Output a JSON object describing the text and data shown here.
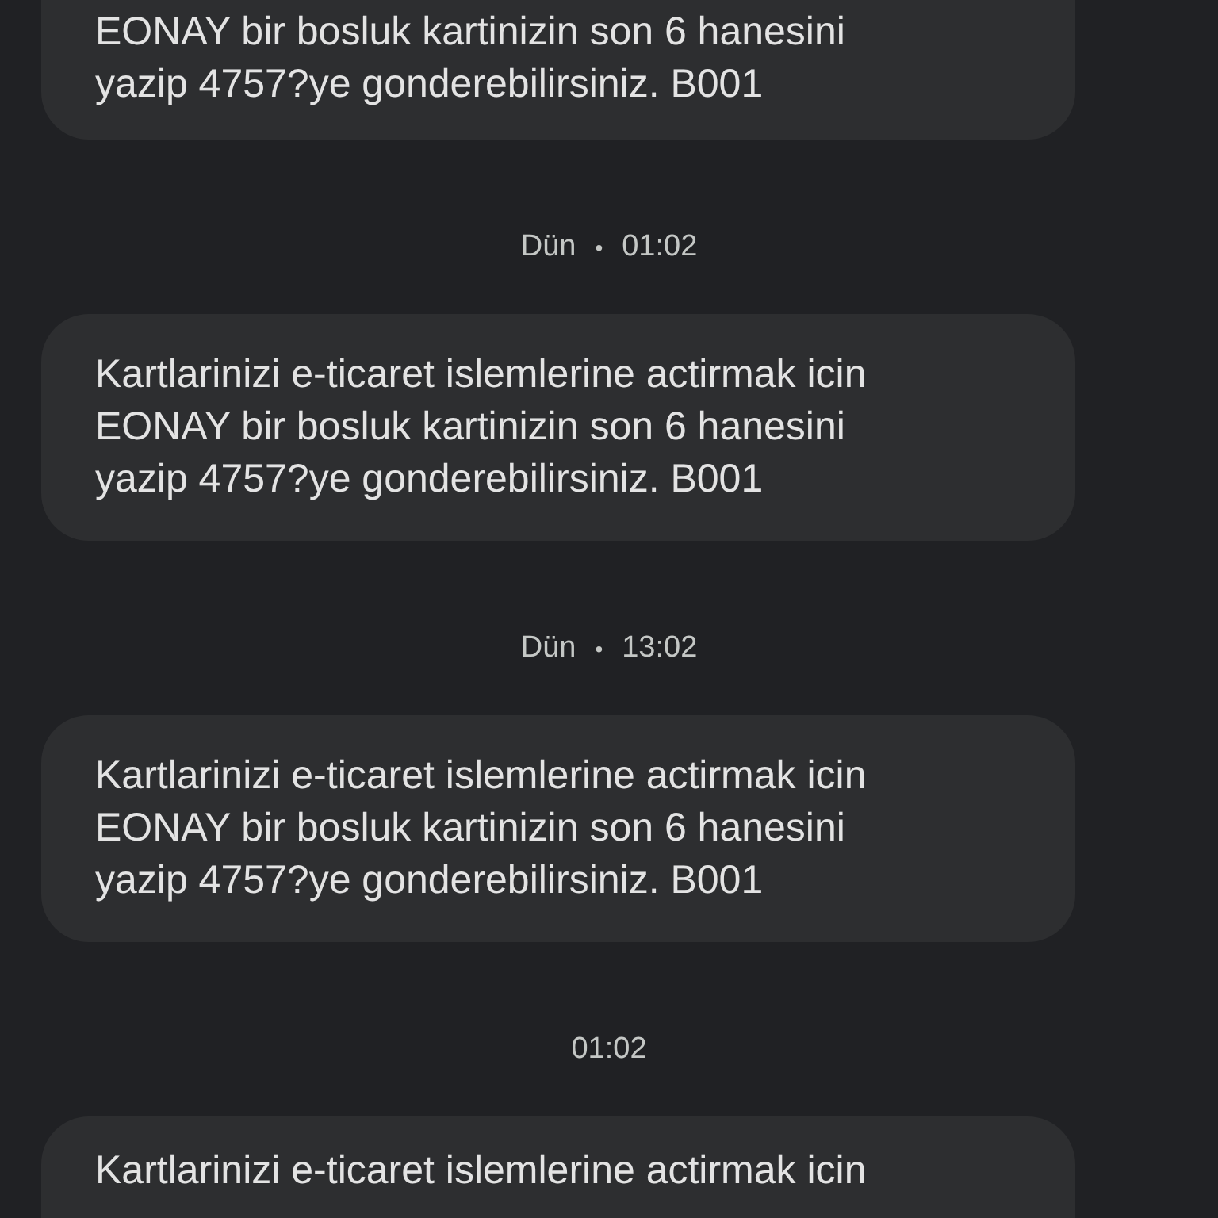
{
  "messages": [
    {
      "lines": [
        "EONAY bir bosluk kartinizin son 6 hanesini",
        "yazip 4757?ye gonderebilirsiniz. B001"
      ]
    },
    {
      "stamp": {
        "day": "Dün",
        "separator": "•",
        "time": "01:02"
      },
      "lines": [
        "Kartlarinizi e-ticaret islemlerine actirmak icin",
        "EONAY bir bosluk kartinizin son 6 hanesini",
        "yazip 4757?ye gonderebilirsiniz. B001"
      ]
    },
    {
      "stamp": {
        "day": "Dün",
        "separator": "•",
        "time": "13:02"
      },
      "lines": [
        "Kartlarinizi e-ticaret islemlerine actirmak icin",
        "EONAY bir bosluk kartinizin son 6 hanesini",
        "yazip 4757?ye gonderebilirsiniz. B001"
      ]
    },
    {
      "stamp": {
        "time": "01:02"
      },
      "lines": [
        "Kartlarinizi e-ticaret islemlerine actirmak icin"
      ]
    }
  ]
}
